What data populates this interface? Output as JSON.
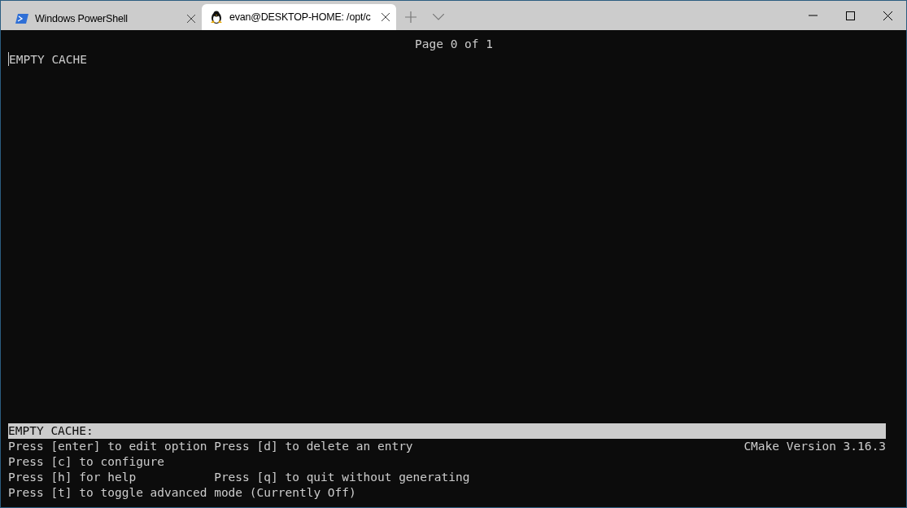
{
  "tabs": [
    {
      "label": "Windows PowerShell",
      "kind": "powershell",
      "selected": false
    },
    {
      "label": "evan@DESKTOP-HOME: /opt/c",
      "kind": "linux",
      "selected": true
    }
  ],
  "terminal": {
    "page_indicator": "Page 0 of 1",
    "entries": [
      "EMPTY CACHE"
    ],
    "status_line": "EMPTY CACHE:",
    "help_lines": [
      {
        "left": "Press [enter] to edit option",
        "right": "Press [d] to delete an entry"
      },
      {
        "left": "Press [c] to configure"
      },
      {
        "left": "Press [h] for help",
        "right": "Press [q] to quit without generating"
      },
      {
        "left": "Press [t] to toggle advanced mode (Currently Off)"
      }
    ],
    "version": "CMake Version 3.16.3"
  }
}
